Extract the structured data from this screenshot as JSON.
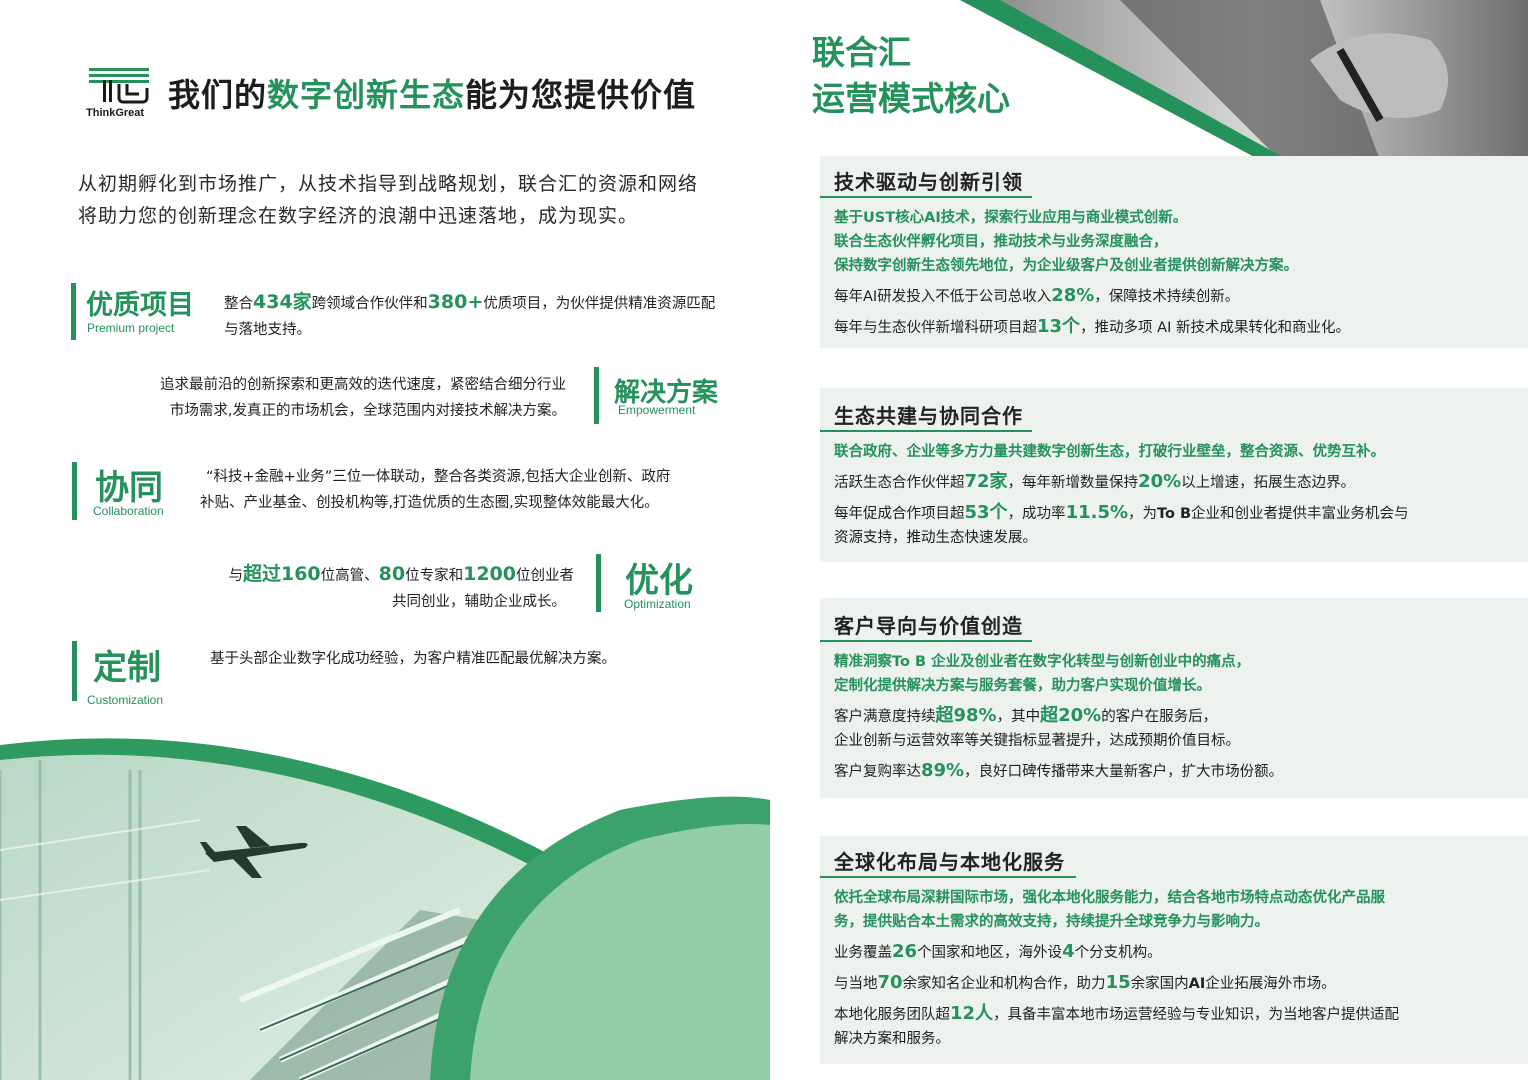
{
  "logo": {
    "name": "ThinkGreat"
  },
  "headline": {
    "part1": "我们的",
    "part2": "数字创新生态",
    "part3": "能为您提供价值"
  },
  "intro": {
    "line1": "从初期孵化到市场推广，从技术指导到战略规划，联合汇的资源和网络",
    "line2": "将助力您的创新理念在数字经济的浪潮中迅速落地，成为现实。"
  },
  "features": {
    "premium": {
      "title": "优质项目",
      "subtitle": "Premium project",
      "d1": "整合",
      "n1": "434家",
      "d2": "跨领域合作伙伴和",
      "n2": "380+",
      "d3": "优质项目，为伙伴提供精准资源匹配与落地支持。"
    },
    "solution": {
      "title": "解决方案",
      "subtitle": "Empowerment",
      "desc1": "追求最前沿的创新探索和更高效的迭代速度，紧密结合细分行业",
      "desc2": "市场需求,发真正的市场机会，全球范围内对接技术解决方案。"
    },
    "collab": {
      "title": "协同",
      "subtitle": "Collaboration",
      "desc1": "“科技+金融+业务”三位一体联动，整合各类资源,包括大企业创新、政府",
      "desc2": "补贴、产业基金、创投机构等,打造优质的生态圈,实现整体效能最大化。"
    },
    "optimize": {
      "title": "优化",
      "subtitle": "Optimization",
      "d1": "与",
      "n1": "超过160",
      "d2": "位高管、",
      "n2": "80",
      "d3": "位专家和",
      "n3": "1200",
      "d4": "位创业者",
      "desc2": "共同创业，辅助企业成长。"
    },
    "custom": {
      "title": "定制",
      "subtitle": "Customization",
      "desc": "基于头部企业数字化成功经验，为客户精准匹配最优解决方案。"
    }
  },
  "right": {
    "title1": "联合汇",
    "title2": "运营模式核心",
    "cards": [
      {
        "title": "技术驱动与创新引领",
        "h1": "基于UST核心AI技术，探索行业应用与商业模式创新。",
        "h2": "联合生态伙伴孵化项目，推动技术与业务深度融合，",
        "h3": "保持数字创新生态领先地位，为企业级客户及创业者提供创新解决方案。",
        "p1a": "每年AI研发投入不低于公司总收入",
        "p1n": "28%",
        "p1b": "，保障技术持续创新。",
        "p2a": "每年与生态伙伴新增科研项目超",
        "p2n": "13个",
        "p2b": "，推动多项 AI 新技术成果转化和商业化。"
      },
      {
        "title": "生态共建与协同合作",
        "h1": "联合政府、企业等多方力量共建数字创新生态，打破行业壁垒，整合资源、优势互补。",
        "p1a": "活跃生态合作伙伴超",
        "p1n": "72家",
        "p1b": "，每年新增数量保持",
        "p1n2": "20%",
        "p1c": "以上增速，拓展生态边界。",
        "p2a": "每年促成合作项目超",
        "p2n": "53个",
        "p2b": "，成功率",
        "p2n2": "11.5%",
        "p2c": "，为",
        "p2d": "To B",
        "p2e": "企业和创业者提供丰富业务机会与",
        "p2f": "资源支持，推动生态快速发展。"
      },
      {
        "title": "客户导向与价值创造",
        "h1": "精准洞察To B 企业及创业者在数字化转型与创新创业中的痛点，",
        "h2": "定制化提供解决方案与服务套餐，助力客户实现价值增长。",
        "p1a": "客户满意度持续",
        "p1n": "超98%",
        "p1b": "，其中",
        "p1n2": "超20%",
        "p1c": "的客户在服务后，",
        "p1d": "企业创新与运营效率等关键指标显著提升，达成预期价值目标。",
        "p2a": "客户复购率达",
        "p2n": "89%",
        "p2b": "，良好口碑传播带来大量新客户，扩大市场份额。"
      },
      {
        "title": "全球化布局与本地化服务",
        "h1": "依托全球布局深耕国际市场，强化本地化服务能力，结合各地市场特点动态优化产品服",
        "h2": "务，提供贴合本土需求的高效支持，持续提升全球竞争力与影响力。",
        "p1a": "业务覆盖",
        "p1n": "26",
        "p1b": "个国家和地区，海外设",
        "p1n2": "4",
        "p1c": "个分支机构。",
        "p2a": "与当地",
        "p2n": "70",
        "p2b": "余家知名企业和机构合作，助力",
        "p2n2": "15",
        "p2c": "余家国内",
        "p2d": "AI",
        "p2e": "企业拓展海外市场。",
        "p3a": "本地化服务团队超",
        "p3n": "12人",
        "p3b": "，具备丰富本地市场运营经验与专业知识，为当地客户提供适配",
        "p3c": "解决方案和服务。"
      }
    ]
  }
}
